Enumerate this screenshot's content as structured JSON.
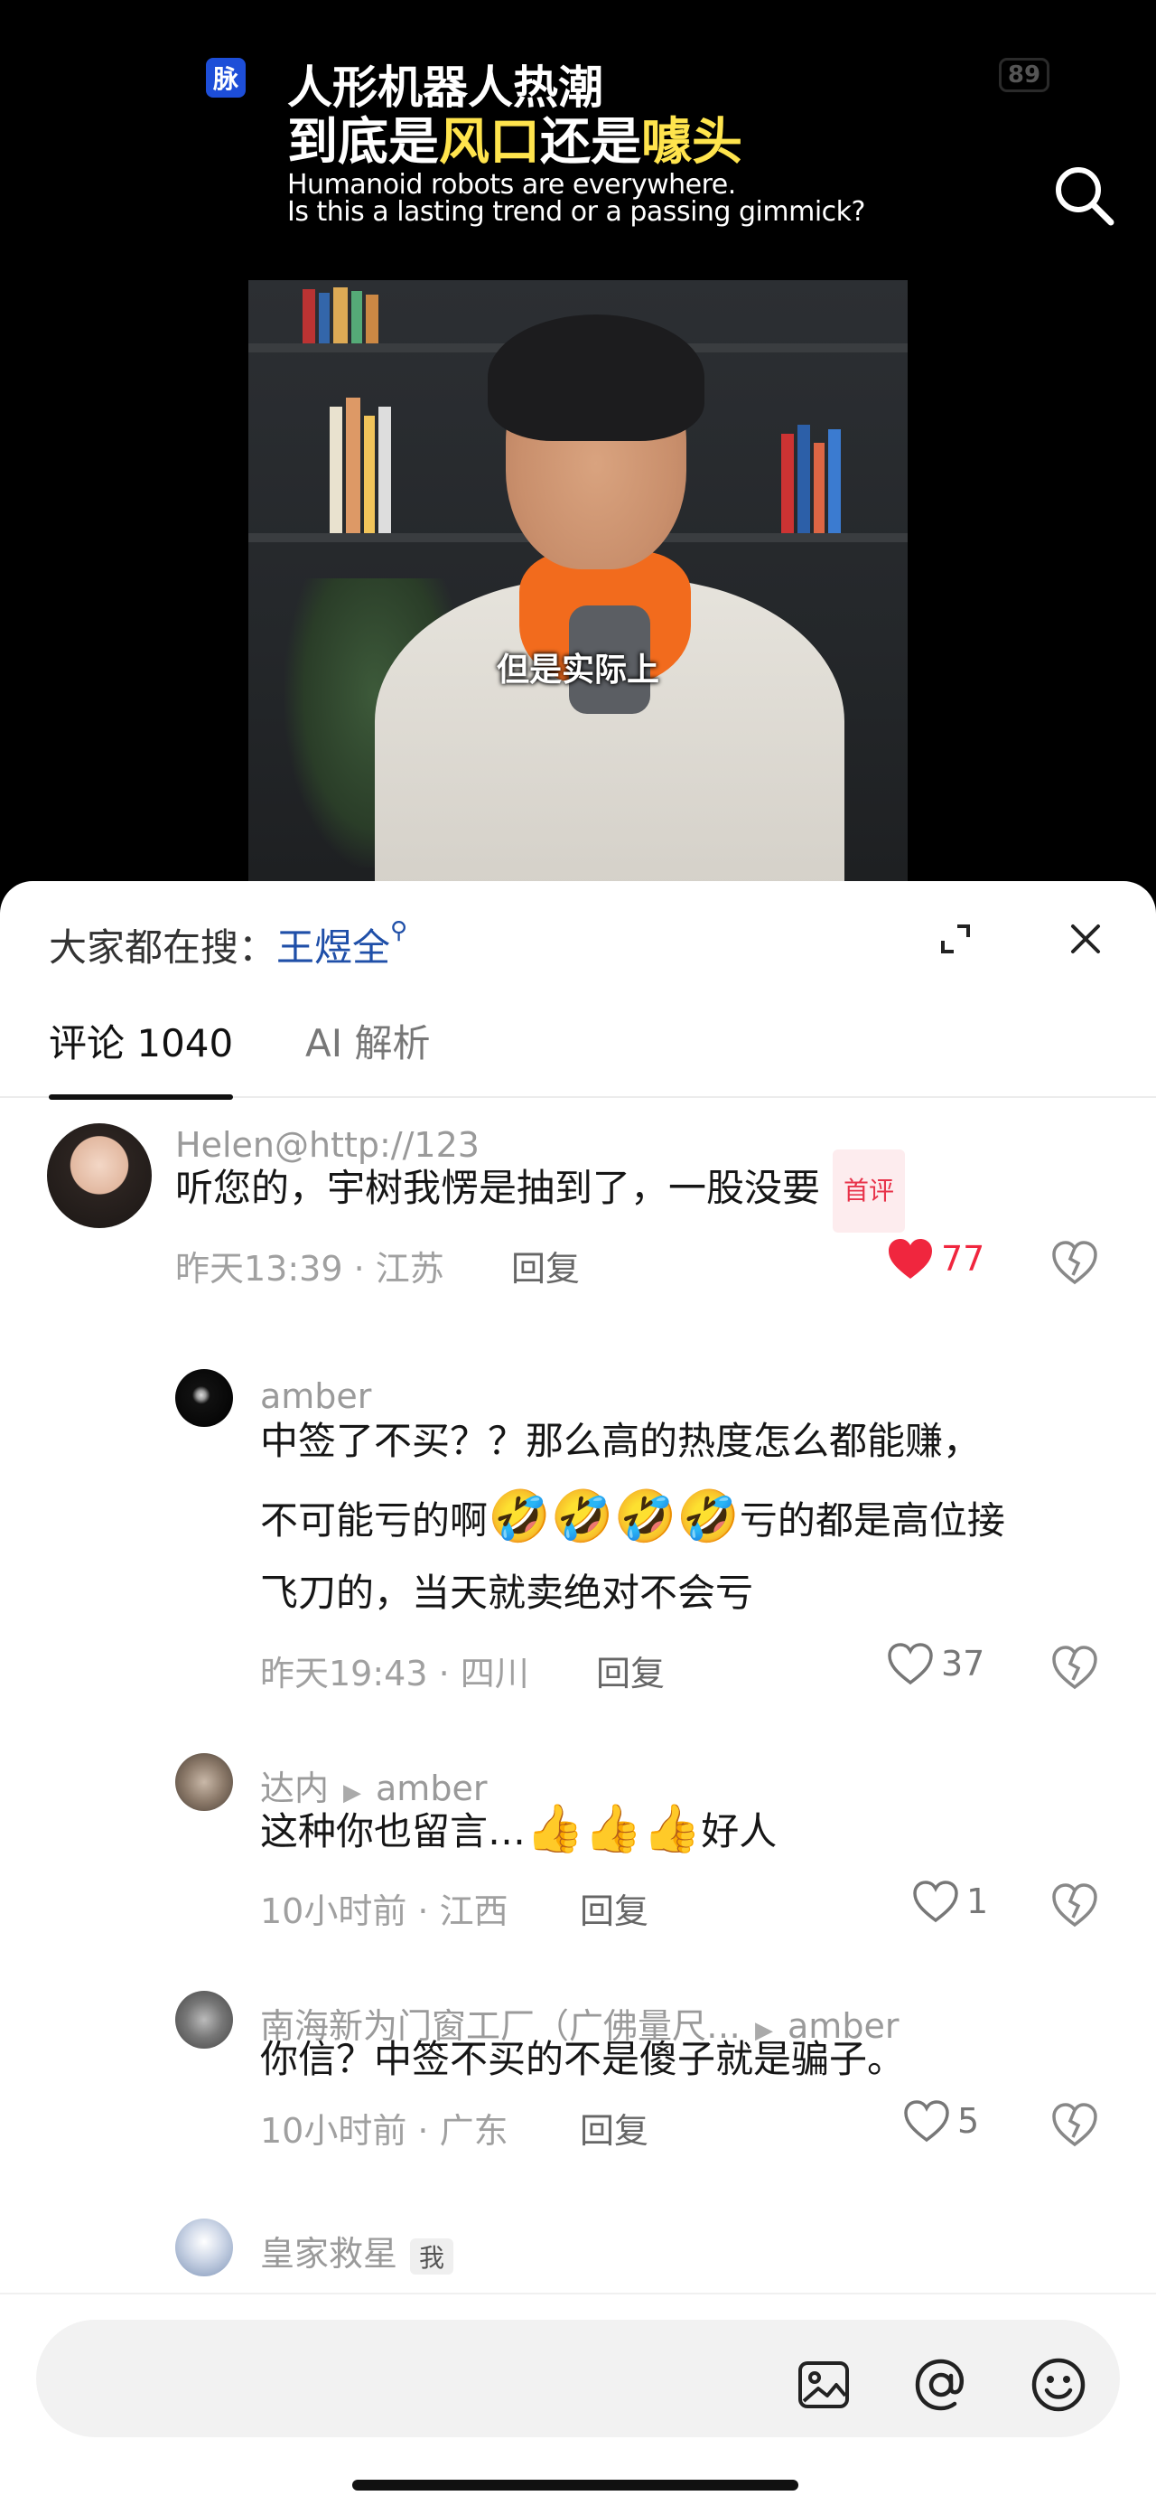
{
  "video": {
    "badge": "脉",
    "battery": "89",
    "title_line1": "人形机器人热潮",
    "title_line2_a": "到底是",
    "title_line2_b": "风口",
    "title_line2_c": "还是",
    "title_line2_d": "噱头",
    "title_en_1": "Humanoid robots are everywhere.",
    "title_en_2": "Is this a lasting trend or a passing gimmick?",
    "subtitle": "但是实际上"
  },
  "trending": {
    "label": "大家都在搜：",
    "query": "王煜全"
  },
  "tabs": {
    "comments": "评论 1040",
    "ai": "AI 解析"
  },
  "comments": [
    {
      "user": "Helen@http://123",
      "text": "听您的，宇树我愣是抽到了，一股没要",
      "tag": "首评",
      "time": "昨天13:39 · 江苏",
      "reply": "回复",
      "likes": "77"
    },
    {
      "user": "amber",
      "text_1": "中签了不买？？那么高的热度怎么都能赚，",
      "text_2a": "不可能亏的啊",
      "emoji": "🤣🤣🤣🤣",
      "text_2b": "亏的都是高位接",
      "text_3": "飞刀的，当天就卖绝对不会亏",
      "time": "昨天19:43 · 四川",
      "reply": "回复",
      "likes": "37"
    },
    {
      "user": "达内",
      "to": "amber",
      "text_a": "这种你也留言…",
      "emoji": "👍👍👍",
      "text_b": "好人",
      "time": "10小时前 · 江西",
      "reply": "回复",
      "likes": "1"
    },
    {
      "user": "南海新为门窗工厂（广佛量尺…",
      "to": "amber",
      "text": "你信？中签不买的不是傻子就是骗子。",
      "time": "10小时前 · 广东",
      "reply": "回复",
      "likes": "5"
    },
    {
      "user": "皇家救星",
      "tag": "我"
    }
  ],
  "input": {
    "value": ""
  },
  "colors": {
    "accent_blue": "#1f4fa8",
    "like_red": "#f0263e",
    "highlight_yellow": "#ffe44d"
  }
}
